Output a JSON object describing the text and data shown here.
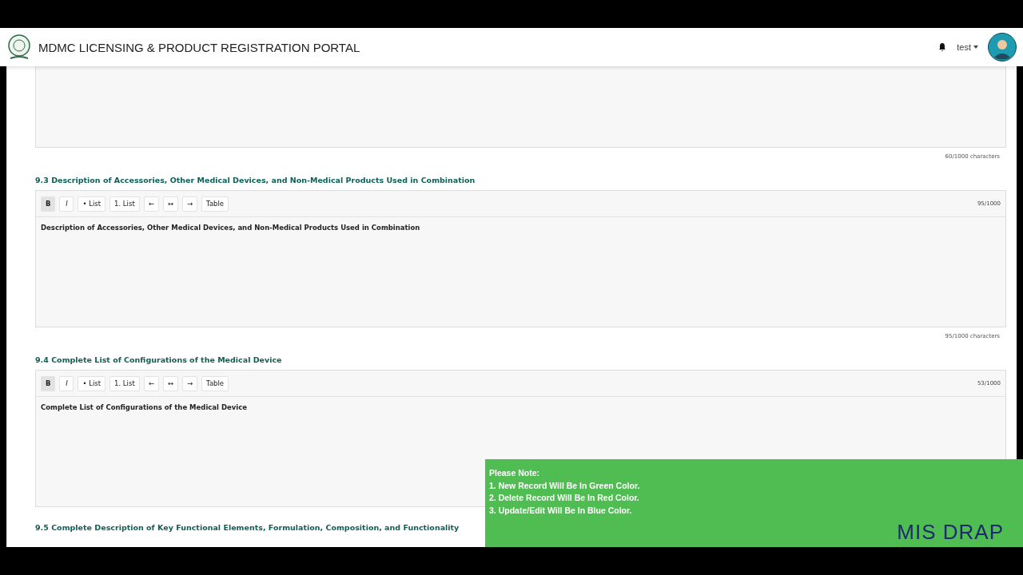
{
  "header": {
    "title": "MDMC LICENSING & PRODUCT REGISTRATION PORTAL",
    "user": "test"
  },
  "top_editor": {
    "counter": "60/1000 characters"
  },
  "sections": [
    {
      "title": "9.3 Description of Accessories, Other Medical Devices, and Non-Medical Products Used in Combination",
      "toolbar": [
        {
          "label": "B",
          "selected": true
        },
        {
          "label": "I",
          "selected": false
        },
        {
          "label": "• List",
          "selected": false
        },
        {
          "label": "1. List",
          "selected": false
        },
        {
          "label": "←",
          "selected": false
        },
        {
          "label": "↔",
          "selected": false
        },
        {
          "label": "→",
          "selected": false
        },
        {
          "label": "Table",
          "selected": false
        }
      ],
      "count": "95/1000",
      "content": "Description of Accessories, Other Medical Devices, and Non-Medical Products Used in Combination",
      "counter": "95/1000 characters"
    },
    {
      "title": "9.4 Complete List of Configurations of the Medical Device",
      "toolbar": [
        {
          "label": "B",
          "selected": true
        },
        {
          "label": "I",
          "selected": false
        },
        {
          "label": "• List",
          "selected": false
        },
        {
          "label": "1. List",
          "selected": false
        },
        {
          "label": "←",
          "selected": false
        },
        {
          "label": "↔",
          "selected": false
        },
        {
          "label": "→",
          "selected": false
        },
        {
          "label": "Table",
          "selected": false
        }
      ],
      "count": "53/1000",
      "content": "Complete List of Configurations of the Medical Device"
    },
    {
      "title": "9.5 Complete Description of Key Functional Elements, Formulation, Composition, and Functionality"
    }
  ],
  "note_banner": {
    "heading": "Please Note:",
    "lines": [
      "1. New Record Will Be In Green Color.",
      "2. Delete Record Will Be In Red Color.",
      "3. Update/Edit Will Be In Blue Color."
    ],
    "brand": "MIS DRAP"
  }
}
